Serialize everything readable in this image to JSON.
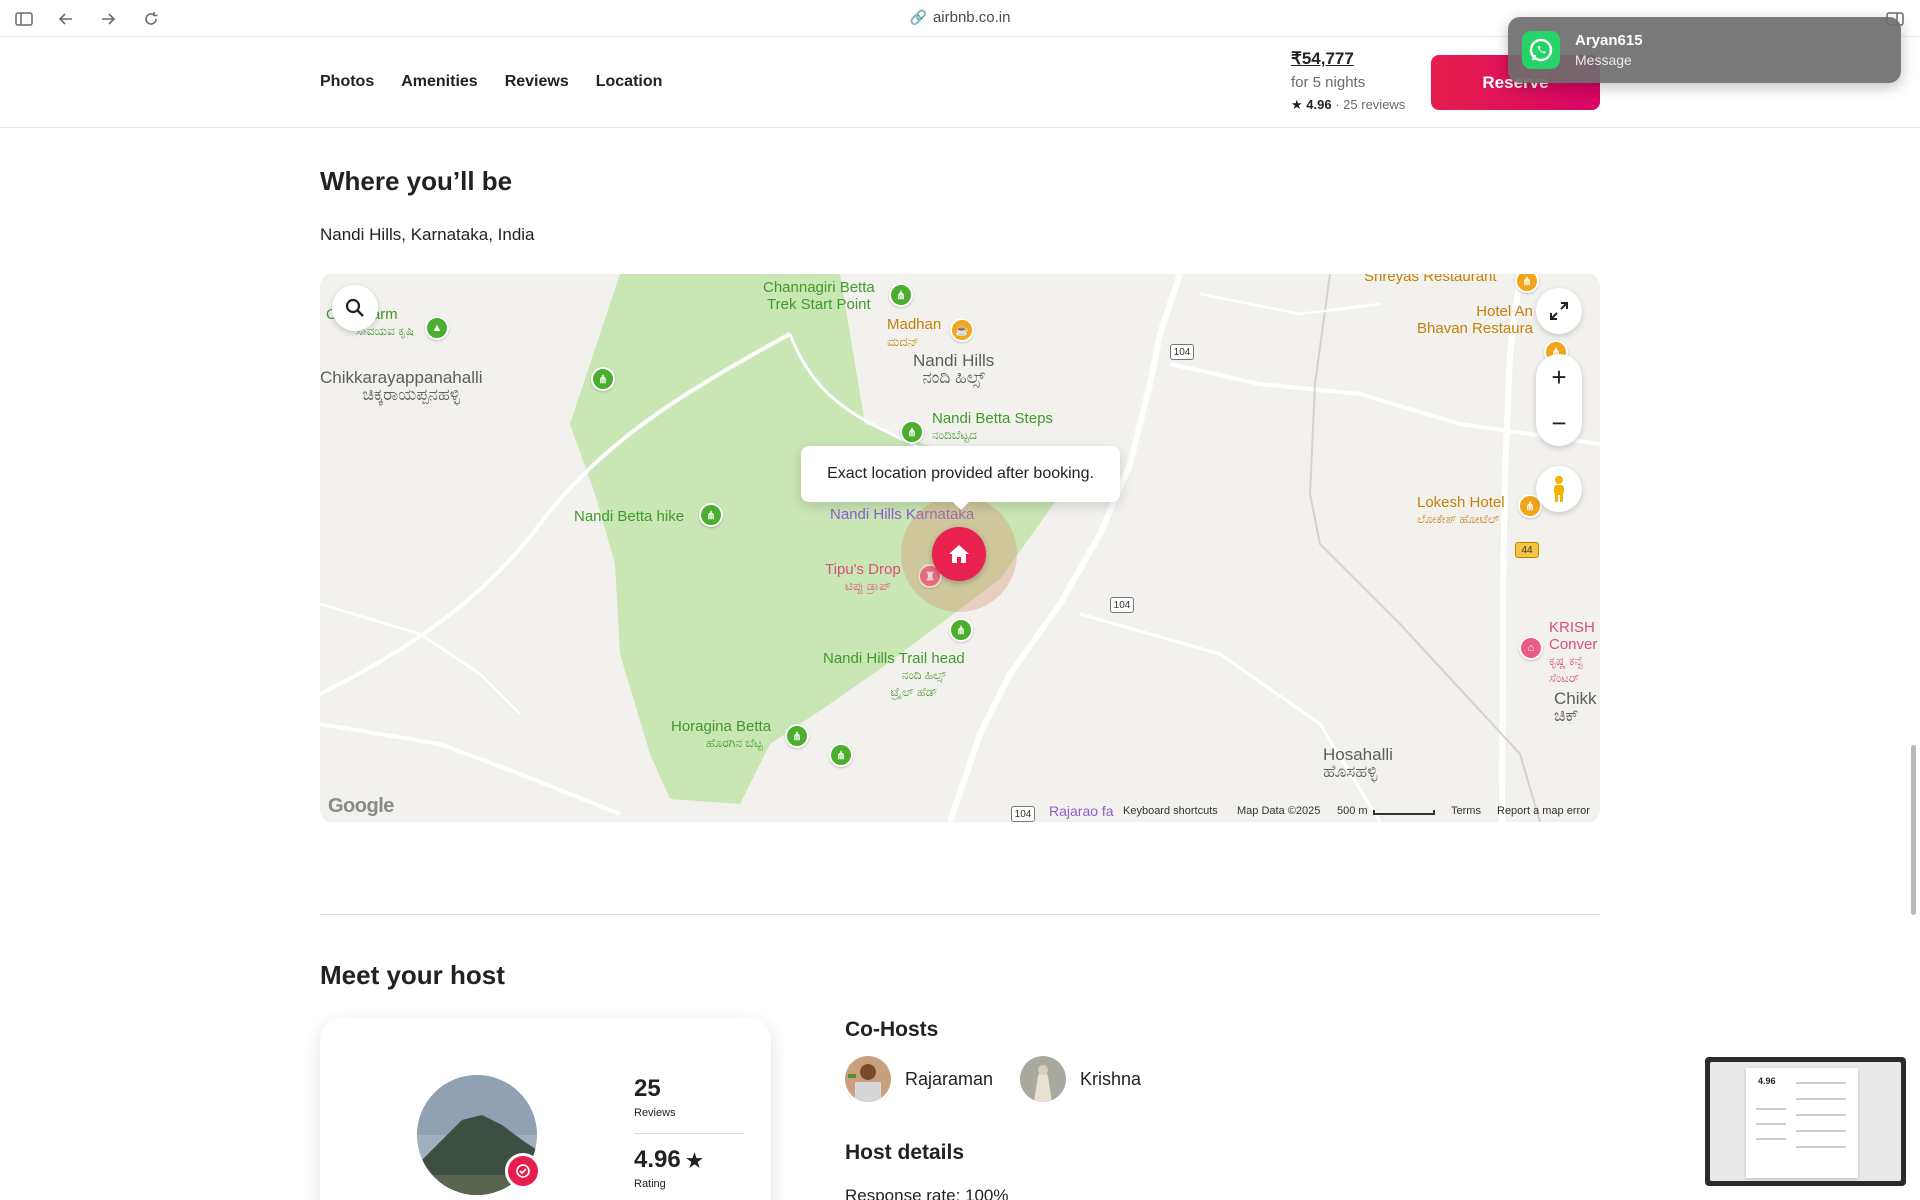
{
  "browser": {
    "url": "airbnb.co.in"
  },
  "subnav": {
    "tabs": [
      "Photos",
      "Amenities",
      "Reviews",
      "Location"
    ],
    "price": "₹54,777",
    "nights": "for 5 nights",
    "rating": "4.96",
    "reviews": "25 reviews",
    "reserve_label": "Reserve"
  },
  "notification": {
    "title": "Aryan615",
    "subtitle": "Message"
  },
  "location": {
    "title": "Where you’ll be",
    "place": "Nandi Hills, Karnataka, India",
    "tooltip": "Exact location provided after booking."
  },
  "map": {
    "labels": {
      "channagiri": "Channagiri Betta",
      "channagiri2": "Trek Start Point",
      "madhan": "Madhan",
      "madhan_kn": "ಮದನ್",
      "nandi_hills": "Nandi Hills",
      "nandi_hills_kn": "ನಂದಿ ಹಿಲ್ಸ್",
      "chikka": "Chikkarayappanahalli",
      "chikka_kn": "ಚಿಕ್ಕರಾಯಪ್ಪನಹಳ್ಳಿ",
      "farm": "farm",
      "farm_o": "O",
      "farm_kn": "ಸಾವಯವ ಕೃಷಿ",
      "steps": "Nandi Betta Steps",
      "steps_kn": "ನಂದಿಬೆಟ್ಟದ",
      "hike": "Nandi Betta hike",
      "karnataka": "Nandi Hills Karnataka",
      "tipu": "Tipu's Drop",
      "tipu_kn": "ಟಿಪ್ಪು ಡ್ರಾಪ್",
      "trail": "Nandi Hills Trail head",
      "trail_kn1": "ನಂದಿ ಹಿಲ್ಸ್",
      "trail_kn2": "ಟ್ರೈಲ್ ಹೆಡ್",
      "horagina": "Horagina Betta",
      "horagina_kn": "ಹೊರಗಿನ ಬೆಟ್ಟ",
      "shreyas": "Shreyas Restaurant",
      "hotel1": "Hotel An",
      "hotel2": "Bhavan Restaura",
      "lokesh": "Lokesh Hotel",
      "lokesh_kn": "ಲೋಕೇಶ್ ಹೋಟೆಲ್",
      "krish1": "KRISH",
      "krish2": "Conver",
      "krish3": "ಕೃಷ್ಣ ಕನ್ವೆ",
      "krish4": "ಸೆಂಟರ್",
      "chikk": "Chikk",
      "chikk_kn": "ಚಿಕ್",
      "hosahalli": "Hosahalli",
      "hosahalli_kn": "ಹೊಸಹಳ್ಳಿ",
      "rajarao": "Rajarao fa"
    },
    "shields": {
      "s1": "104",
      "s2": "104",
      "s3": "44",
      "s4": "104"
    },
    "footer": {
      "google": "Google",
      "shortcuts": "Keyboard shortcuts",
      "mapdata": "Map Data ©2025",
      "scale": "500 m",
      "terms": "Terms",
      "report": "Report a map error"
    }
  },
  "host": {
    "title": "Meet your host",
    "reviews_num": "25",
    "reviews_cap": "Reviews",
    "rating_num": "4.96",
    "rating_cap": "Rating",
    "cohosts_title": "Co-Hosts",
    "cohosts": [
      "Rajaraman",
      "Krishna"
    ],
    "details_title": "Host details",
    "response_rate": "Response rate: 100%"
  },
  "thumbnail": {
    "rating": "4.96"
  },
  "colors": {
    "accent": "#e61e4d",
    "park_green": "#c9e6b5",
    "map_bg": "#f3f1ed"
  }
}
